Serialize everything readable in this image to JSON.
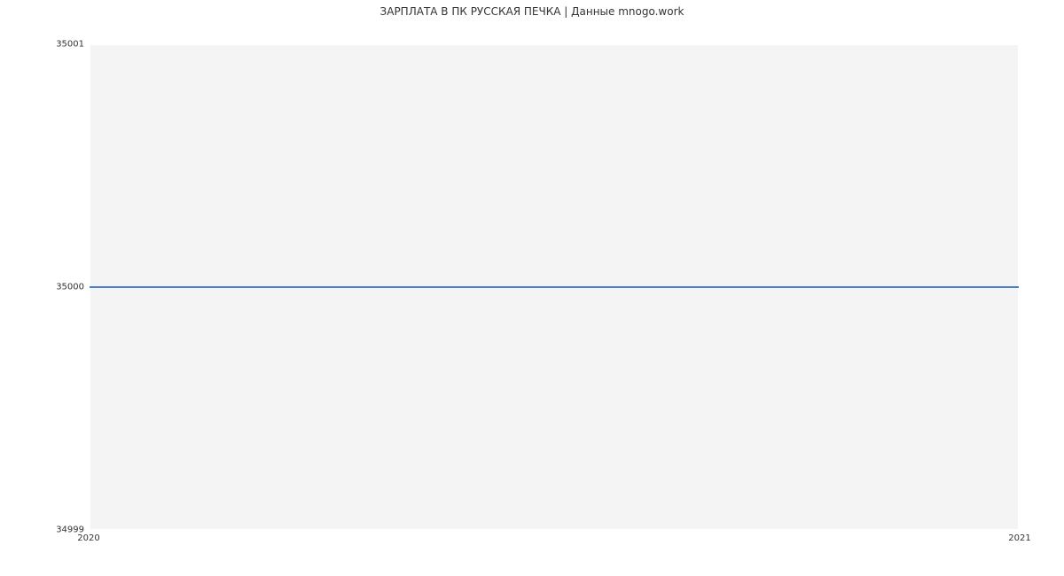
{
  "chart_data": {
    "type": "line",
    "title": "ЗАРПЛАТА В ПК РУССКАЯ ПЕЧКА | Данные mnogo.work",
    "x": [
      "2020",
      "2021"
    ],
    "values": [
      35000,
      35000
    ],
    "xlim": [
      "2020",
      "2021"
    ],
    "ylim": [
      34999,
      35001
    ],
    "y_ticks": [
      34999,
      35000,
      35001
    ],
    "x_ticks": [
      "2020",
      "2021"
    ],
    "xlabel": "",
    "ylabel": ""
  }
}
